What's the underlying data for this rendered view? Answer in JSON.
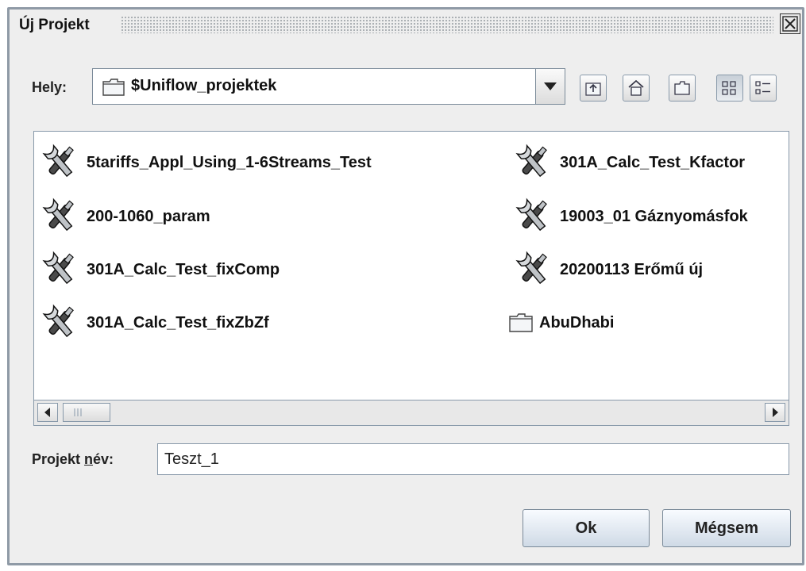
{
  "window": {
    "title": "Új Projekt"
  },
  "location": {
    "label": "Hely:",
    "value": "$Uniflow_projektek"
  },
  "toolbar": {
    "buttons": [
      {
        "name": "up-folder"
      },
      {
        "name": "home"
      },
      {
        "name": "new-folder"
      },
      {
        "name": "list-view"
      },
      {
        "name": "details-view"
      }
    ]
  },
  "files": [
    {
      "label": "5tariffs_Appl_Using_1-6Streams_Test",
      "icon": "project-tools-icon"
    },
    {
      "label": "200-1060_param",
      "icon": "project-tools-icon"
    },
    {
      "label": "301A_Calc_Test_fixComp",
      "icon": "project-tools-icon"
    },
    {
      "label": "301A_Calc_Test_fixZbZf",
      "icon": "project-tools-icon"
    },
    {
      "label": "301A_Calc_Test_Kfactor",
      "icon": "project-tools-icon"
    },
    {
      "label": "19003_01 Gáznyomásfok",
      "icon": "project-tools-icon"
    },
    {
      "label": "20200113 Erőmű új",
      "icon": "project-tools-icon"
    },
    {
      "label": "AbuDhabi",
      "icon": "folder-icon"
    }
  ],
  "project_name": {
    "label_prefix": "Projekt ",
    "label_mnemonic": "n",
    "label_suffix": "év:",
    "value": "Teszt_1"
  },
  "actions": {
    "ok": "Ok",
    "cancel": "Mégsem"
  }
}
